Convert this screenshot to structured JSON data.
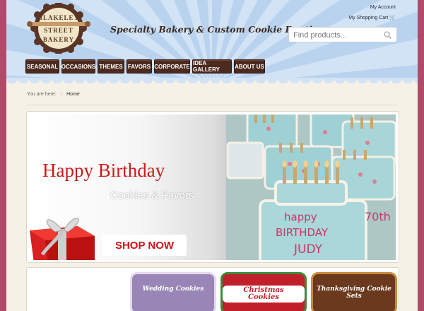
{
  "brand": {
    "logo_lines": [
      "BLAKELEY",
      "STREET",
      "BAKERY"
    ],
    "tagline": "Specialty Bakery & Custom Cookie Boutique"
  },
  "account": {
    "my_account": "My Account",
    "my_cart": "My Shopping Cart"
  },
  "search": {
    "placeholder": "Find products..."
  },
  "nav": {
    "items": [
      "SEASONAL",
      "OCCASIONS",
      "THEMES",
      "FAVORS",
      "CORPORATE",
      "IDEA GALLERY",
      "ABOUT US"
    ]
  },
  "breadcrumb": {
    "prefix": "You are here:",
    "current": "Home"
  },
  "banner": {
    "title": "Happy Birthday",
    "subtitle": "Cookies & Favors",
    "cta": "SHOP NOW",
    "cookie_text": [
      "happy",
      "BIRTHDAY",
      "JUDY",
      "70th"
    ]
  },
  "categories": [
    {
      "label": "Wedding Cookies"
    },
    {
      "label": "Christmas Cookies"
    },
    {
      "label": "Thanksgiving Cookie Sets"
    }
  ],
  "colors": {
    "frame": "#b04a68",
    "nav_bg": "#4c2a1d",
    "accent_red": "#cc1b1b",
    "sky": "#b9d3ef"
  }
}
